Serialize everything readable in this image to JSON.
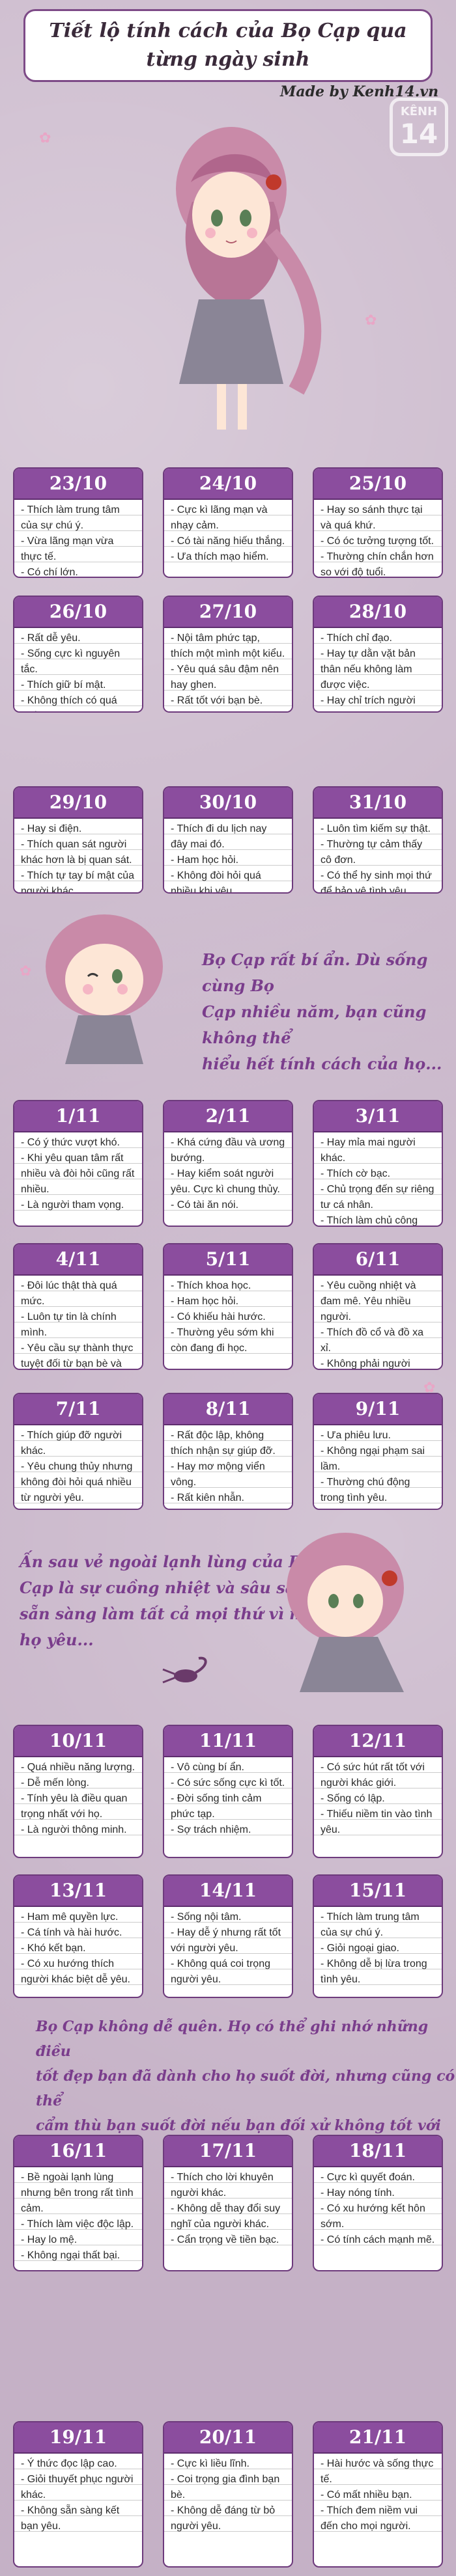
{
  "title": "Tiết lộ tính cách của Bọ Cạp qua\ntừng ngày sinh",
  "made_by": "Made by Kenh14.vn",
  "watermark": {
    "top": "KÊNH",
    "num": "14"
  },
  "quotes": [
    "Bọ Cạp rất bí ẩn. Dù sống cùng Bọ\nCạp nhiều năm, bạn cũng không thể\nhiểu hết tính cách của họ...",
    "Ấn sau vẻ ngoài lạnh lùng của Bọ\nCạp là sự cuồng nhiệt và sâu sắc. Họ\nsẵn sàng làm tất cả mọi thứ vì người\nhọ yêu...",
    "Bọ Cạp không dễ quên. Họ có thể ghi nhớ những điều\ntốt đẹp bạn đã dành cho họ suốt đời, nhưng cũng có thể\ncẩm thù bạn suốt đời nếu bạn đối xử không tốt với họ..."
  ],
  "cards": [
    {
      "date": "23/10",
      "lines": [
        "- Thích làm trung tâm của sự chú ý.",
        "- Vừa lãng mạn vừa thực tế.",
        "- Có chí lớn."
      ]
    },
    {
      "date": "24/10",
      "lines": [
        "- Cực kì lãng mạn và nhạy cảm.",
        "- Có tài năng hiếu thắng.",
        "- Ưa thích mạo hiểm."
      ]
    },
    {
      "date": "25/10",
      "lines": [
        "- Hay so sánh thực tại và quá khứ.",
        "- Có óc tưởng tượng tốt.",
        "- Thường chín chắn hơn so với độ tuổi."
      ]
    },
    {
      "date": "26/10",
      "lines": [
        "- Rất dễ yêu.",
        "- Sống cực kì nguyên tắc.",
        "- Thích giữ bí mật.",
        "- Không thích có quá nhiều người quan tâm."
      ]
    },
    {
      "date": "27/10",
      "lines": [
        "- Nội tâm phức tạp, thích một mình một kiểu.",
        "- Yêu quá sâu đậm nên hay ghen.",
        "- Rất tốt với bạn bè."
      ]
    },
    {
      "date": "28/10",
      "lines": [
        "- Thích chỉ đạo.",
        "- Hay tự dằn vặt bản thân nếu không làm được việc.",
        "- Hay chỉ trích người khác."
      ]
    },
    {
      "date": "29/10",
      "lines": [
        "- Hay si điện.",
        "- Thích quan sát người khác hơn là bị quan sát.",
        "- Thích tự tay bí mật của người khác."
      ]
    },
    {
      "date": "30/10",
      "lines": [
        "- Thích đi du lịch nay đây mai đó.",
        "- Ham học hỏi.",
        "- Không đòi hỏi quá nhiều khi yêu."
      ]
    },
    {
      "date": "31/10",
      "lines": [
        "- Luôn tìm kiếm sự thật.",
        "- Thường tự cảm thấy cô đơn.",
        "- Có thể hy sinh mọi thứ để bảo vệ tình yêu."
      ]
    },
    {
      "date": "1/11",
      "lines": [
        "- Có ý thức vượt khó.",
        "- Khi yêu quan tâm rất nhiều và đòi hỏi cũng rất nhiều.",
        "- Là người tham vọng."
      ]
    },
    {
      "date": "2/11",
      "lines": [
        "- Khá cứng đầu và ương bướng.",
        "- Hay kiểm soát người yêu. Cực kì chung thủy.",
        "- Có tài ăn nói."
      ]
    },
    {
      "date": "3/11",
      "lines": [
        "- Hay mỉa mai người khác.",
        "- Thích cờ bạc.",
        "- Chủ trọng đến sự riêng tư cá nhân.",
        "- Thích làm chủ công việc."
      ]
    },
    {
      "date": "4/11",
      "lines": [
        "- Đôi lúc thật thà quá mức.",
        "- Luôn tự tin là chính mình.",
        "- Yêu cầu sự thành thực tuyệt đối từ bạn bè và người yêu."
      ]
    },
    {
      "date": "5/11",
      "lines": [
        "- Thích khoa học.",
        "- Ham học hỏi.",
        "- Có khiếu hài hước.",
        "- Thường yêu sớm khi còn đang đi học."
      ]
    },
    {
      "date": "6/11",
      "lines": [
        "- Yêu cuồng nhiệt và đam mê. Yêu nhiều người.",
        "- Thích đồ cổ và đồ xa xỉ.",
        "- Không phải người tham vọng."
      ]
    },
    {
      "date": "7/11",
      "lines": [
        "- Thích giúp đỡ người khác.",
        "- Yêu chung thủy nhưng không đòi hỏi quá nhiều từ người yêu."
      ]
    },
    {
      "date": "8/11",
      "lines": [
        "- Rất độc lập, không thích nhận sự giúp đỡ.",
        "- Hay mơ mộng viển vông.",
        "- Rất kiên nhẫn."
      ]
    },
    {
      "date": "9/11",
      "lines": [
        "- Ưa phiêu lưu.",
        "- Không ngại phạm sai lầm.",
        "- Thường chú động trong tình yêu."
      ]
    },
    {
      "date": "10/11",
      "lines": [
        "- Quá nhiều năng lượng.",
        "- Dễ mến lòng.",
        "- Tính yêu là điều quan trọng nhất với họ.",
        "- Là người thông minh."
      ]
    },
    {
      "date": "11/11",
      "lines": [
        "- Vô cùng bí ẩn.",
        "- Có sức sống cực kì tốt.",
        "- Đời sống tinh cảm phức tạp.",
        "- Sợ trách nhiệm."
      ]
    },
    {
      "date": "12/11",
      "lines": [
        "- Có sức hút rất tốt với người khác giới.",
        "- Sống có lập.",
        "- Thiếu niềm tin vào tình yêu."
      ]
    },
    {
      "date": "13/11",
      "lines": [
        "- Ham mê quyền lực.",
        "- Cá tính và hài hước.",
        "- Khó kết bạn.",
        "- Có xu hướng thích người khác biệt dễ yêu."
      ]
    },
    {
      "date": "14/11",
      "lines": [
        "- Sống nội tâm.",
        "- Hay dễ ý nhưng rất tốt với người yêu.",
        "- Không quá coi trọng người yêu."
      ]
    },
    {
      "date": "15/11",
      "lines": [
        "- Thích làm trung tâm của sự chú ý.",
        "- Giỏi ngoại giao.",
        "- Không dễ bị lừa trong tình yêu."
      ]
    },
    {
      "date": "16/11",
      "lines": [
        "- Bề ngoài lạnh lùng nhưng bên trong rất tình cảm.",
        "- Thích làm việc độc lập.",
        "- Hay lo mệ.",
        "- Không ngại thất bại."
      ]
    },
    {
      "date": "17/11",
      "lines": [
        "- Thích cho lời khuyên người khác.",
        "- Không dễ thay đổi suy nghĩ của người khác.",
        "- Cẩn trọng về tiền bạc."
      ]
    },
    {
      "date": "18/11",
      "lines": [
        "- Cực kì quyết đoán.",
        "- Hay nóng tính.",
        "- Có xu hướng kết hôn sớm.",
        "- Có tính cách mạnh mẽ."
      ]
    },
    {
      "date": "19/11",
      "lines": [
        "- Ý thức đọc lập cao.",
        "- Giỏi thuyết phục người khác.",
        "- Không sẵn sàng kết bạn yêu."
      ]
    },
    {
      "date": "20/11",
      "lines": [
        "- Cực kì liều lĩnh.",
        "- Coi trọng gia đình bạn bè.",
        "- Không dễ đáng từ bỏ người yêu."
      ]
    },
    {
      "date": "21/11",
      "lines": [
        "- Hài hước và sống thực tế.",
        "- Có mất nhiều bạn.",
        "- Thích đem niềm vui đến cho mọi người."
      ]
    }
  ]
}
